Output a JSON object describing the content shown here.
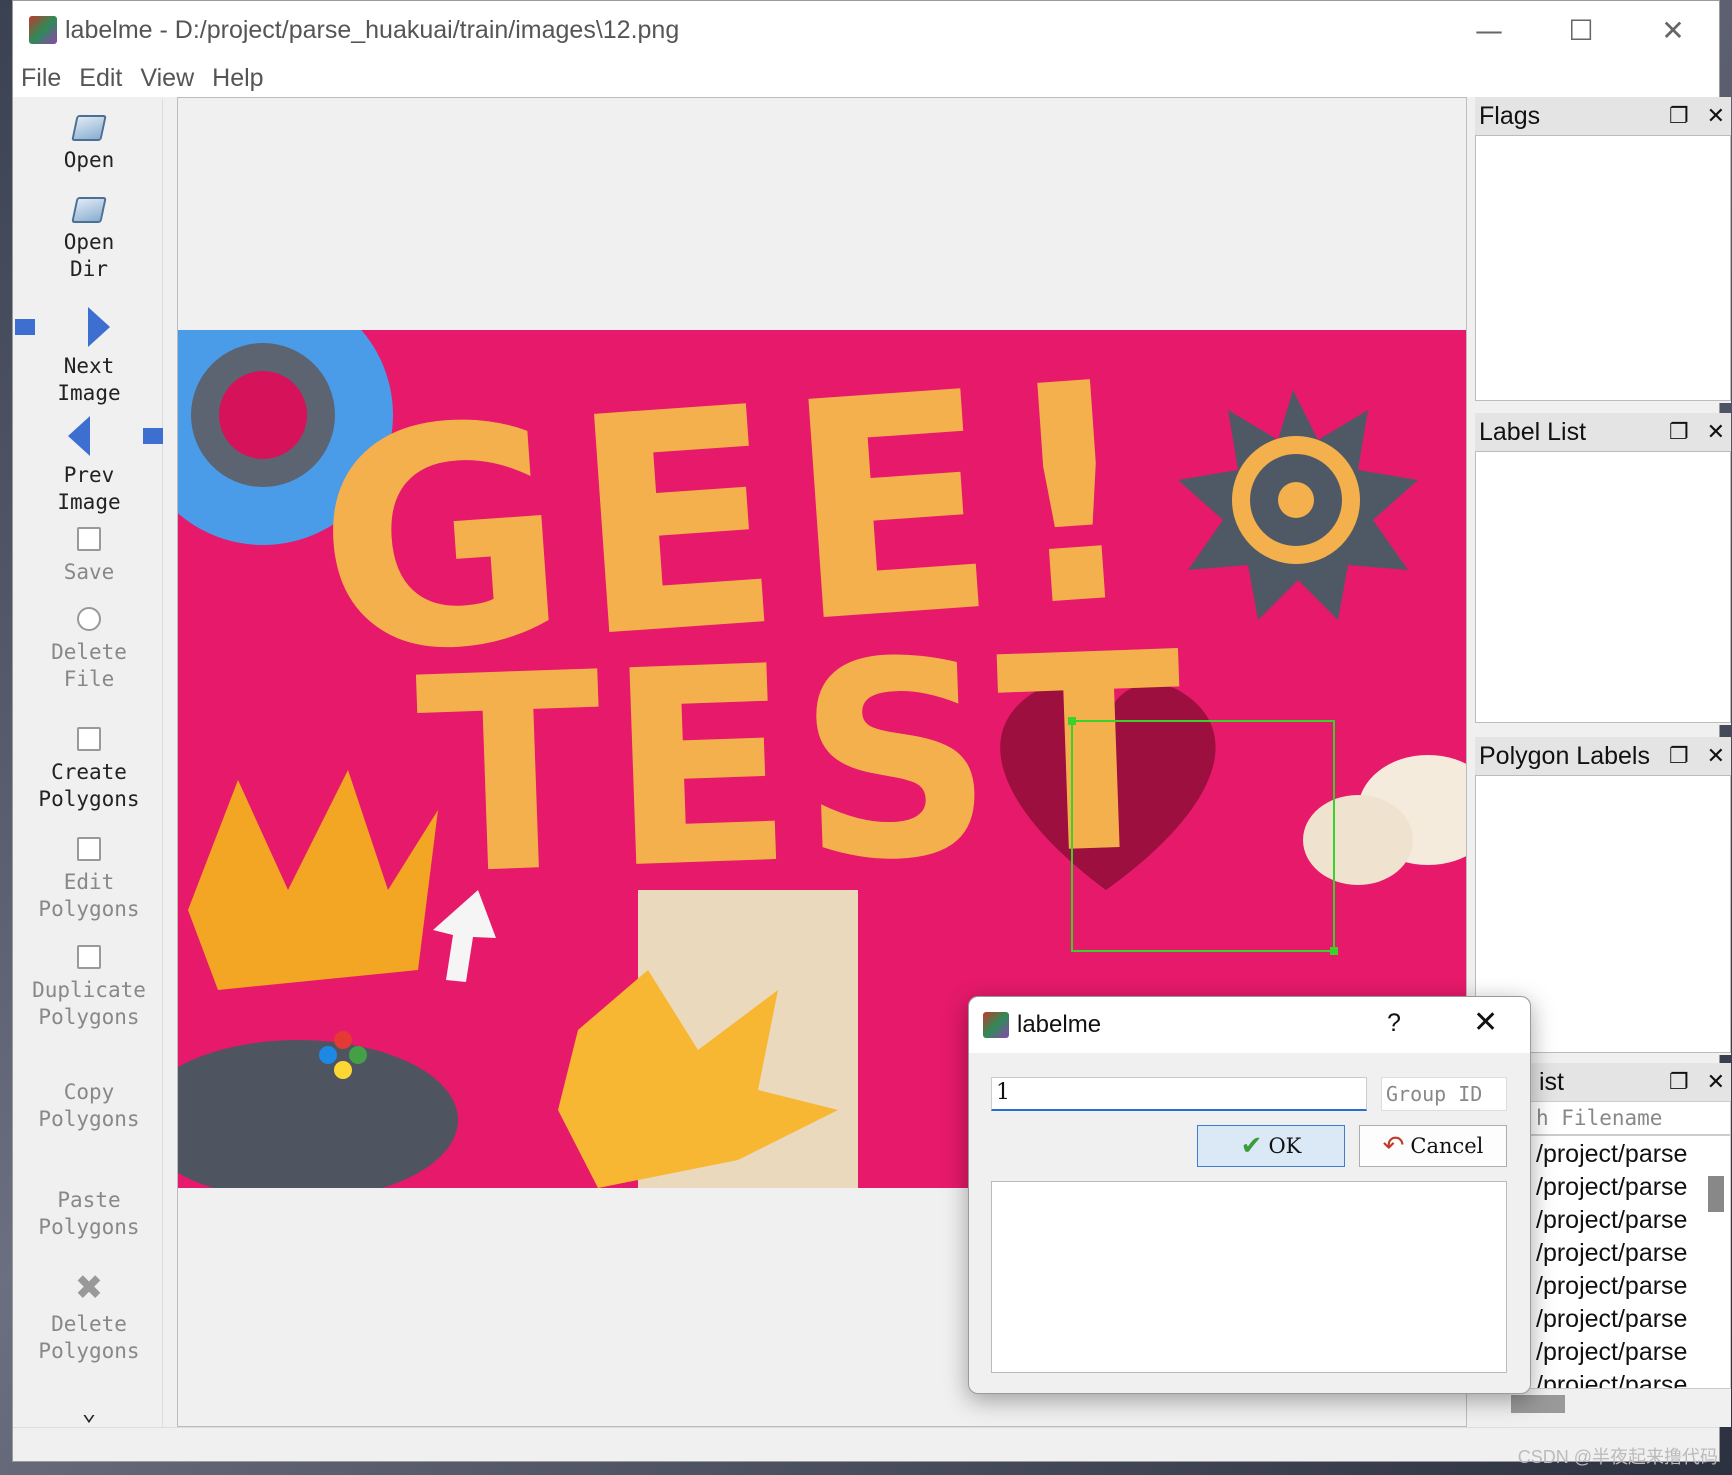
{
  "window": {
    "title": "labelme - D:/project/parse_huakuai/train/images\\12.png",
    "controls": {
      "minimize": "—",
      "maximize": "☐",
      "close": "✕"
    }
  },
  "menu": [
    "File",
    "Edit",
    "View",
    "Help"
  ],
  "toolbar": {
    "open": "Open",
    "open_dir_1": "Open",
    "open_dir_2": "Dir",
    "next_1": "Next",
    "next_2": "Image",
    "prev_1": "Prev",
    "prev_2": "Image",
    "save": "Save",
    "delete_file_1": "Delete",
    "delete_file_2": "File",
    "create_1": "Create",
    "create_2": "Polygons",
    "edit_1": "Edit",
    "edit_2": "Polygons",
    "dup_1": "Duplicate",
    "dup_2": "Polygons",
    "copy_1": "Copy",
    "copy_2": "Polygons",
    "paste_1": "Paste",
    "paste_2": "Polygons",
    "del_poly_1": "Delete",
    "del_poly_2": "Polygons",
    "more": "⌄"
  },
  "image": {
    "text_line1": "GEE!",
    "text_line2": "TEST"
  },
  "docks": {
    "flags": "Flags",
    "label_list": "Label List",
    "polygon_labels": "Polygon Labels",
    "file_list": "ist",
    "file_search_placeholder": "h Filename",
    "files": [
      "/project/parse",
      "/project/parse",
      "/project/parse",
      "/project/parse",
      "/project/parse",
      "/project/parse",
      "/project/parse",
      "/project/parse"
    ]
  },
  "dialog": {
    "title": "labelme",
    "help": "?",
    "close": "✕",
    "label_value": "1",
    "group_id_placeholder": "Group ID",
    "ok": "OK",
    "cancel": "Cancel"
  },
  "watermark": "CSDN @半夜起来撸代码",
  "colors": {
    "image_bg": "#e6196a",
    "letters": "#f5b04e",
    "bbox": "#39d12a",
    "accent": "#2a6cd6"
  }
}
